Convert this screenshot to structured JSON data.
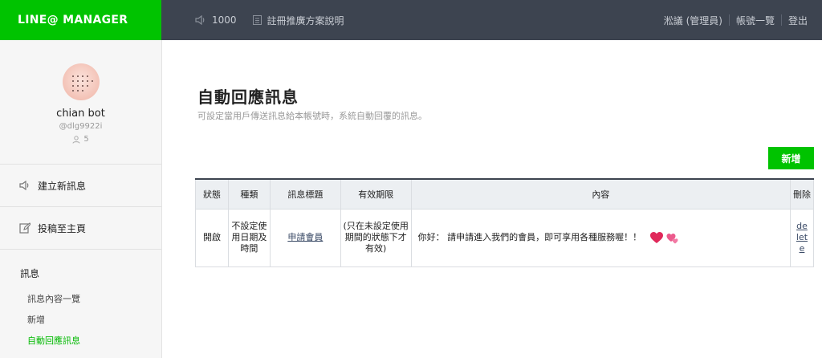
{
  "brand": {
    "name": "LINE@ MANAGER"
  },
  "topbar": {
    "message_count": "1000",
    "plan_link": "註冊推廣方案說明",
    "user": "淞議 (管理員)",
    "accounts": "帳號一覽",
    "logout": "登出"
  },
  "sidebar": {
    "profile": {
      "name": "chian bot",
      "id": "@dlg9922i",
      "followers": "5"
    },
    "nav": [
      {
        "label": "建立新訊息",
        "icon": "speaker-icon"
      },
      {
        "label": "投稿至主頁",
        "icon": "edit-icon"
      }
    ],
    "section_title": "訊息",
    "sub_items": [
      {
        "label": "訊息內容一覽"
      },
      {
        "label": "新增"
      },
      {
        "label": "自動回應訊息"
      }
    ]
  },
  "main": {
    "title": "自動回應訊息",
    "subtitle": "可設定當用戶傳送訊息給本帳號時，系統自動回覆的訊息。",
    "add_button": "新增",
    "table": {
      "headers": [
        "狀態",
        "種類",
        "訊息標題",
        "有效期限",
        "內容",
        "刪除"
      ],
      "rows": [
        {
          "status": "開啟",
          "type": "不設定使用日期及時間",
          "title": "申請會員",
          "validity": "(只在未設定使用期間的狀態下才有效)",
          "content": "你好： 請申請進入我們的會員，即可享用各種服務喔！！",
          "delete": "delete"
        }
      ]
    }
  },
  "colors": {
    "brand_green": "#00c300",
    "topbar": "#3d4450",
    "active_green": "#00b900"
  }
}
